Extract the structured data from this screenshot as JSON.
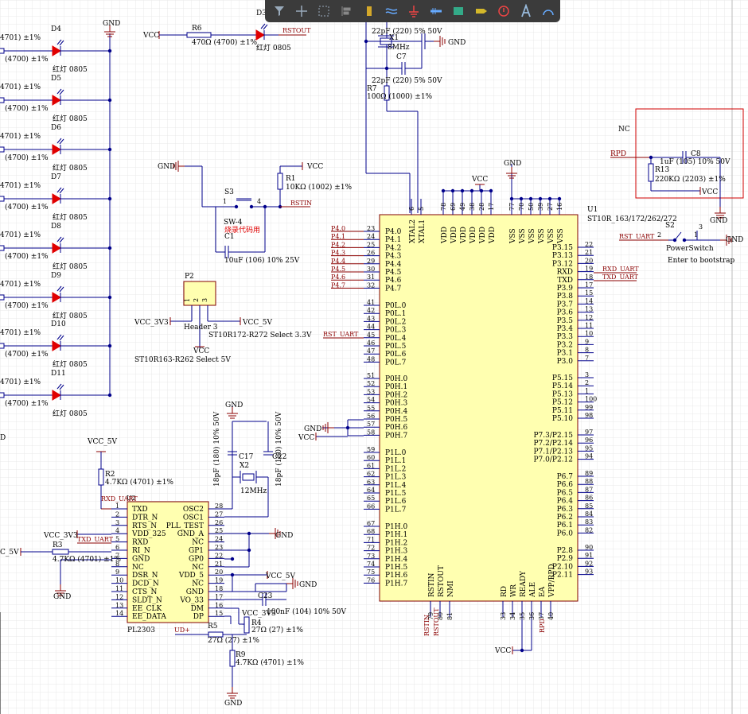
{
  "labels": {
    "gnd": "GND",
    "vcc": "VCC",
    "vcc_3v3": "VCC_3V3",
    "vcc_5v": "VCC_5V",
    "rstout": "RSTOUT",
    "rstin": "RSTIN",
    "rst_uart": "RST_UART",
    "rxd_uart": "RXD_UART",
    "txd_uart": "TXD_UART",
    "rpd": "RPD",
    "nc": "NC",
    "ud_plus": "UD+",
    "vcc_5v_short": "C_5V",
    "d_fragment": "D"
  },
  "leds": [
    {
      "ref": "D4",
      "r_value": "(4700) ±1%",
      "r_top": "4701) ±1%",
      "part": "红灯 0805"
    },
    {
      "ref": "D5",
      "r_value": "(4700) ±1%",
      "r_top": "4701) ±1%",
      "part": "红灯 0805"
    },
    {
      "ref": "D6",
      "r_value": "(4700) ±1%",
      "r_top": "4701) ±1%",
      "part": "红灯 0805"
    },
    {
      "ref": "D7",
      "r_value": "(4700) ±1%",
      "r_top": "4701) ±1%",
      "part": "红灯 0805"
    },
    {
      "ref": "D8",
      "r_value": "(4700) ±1%",
      "r_top": "4701) ±1%",
      "part": "红灯 0805"
    },
    {
      "ref": "D9",
      "r_value": "(4700) ±1%",
      "r_top": "4701) ±1%",
      "part": "红灯 0805"
    },
    {
      "ref": "D10",
      "r_value": "(4700) ±1%",
      "r_top": "4701) ±1%",
      "part": "红灯 0805"
    },
    {
      "ref": "D11",
      "r_value": "(4700) ±1%",
      "r_top": "4701) ±1%",
      "part": "红灯 0805"
    }
  ],
  "components": {
    "r6": {
      "ref": "R6",
      "value": "470Ω (4700) ±1%"
    },
    "d3": {
      "ref": "D3",
      "part": "红灯 0805"
    },
    "c_top": {
      "value": "22pF (220) 5% 50V"
    },
    "x1": {
      "ref": "X1",
      "value": "8MHz"
    },
    "c7": {
      "ref": "C7",
      "value": "22pF (220) 5% 50V"
    },
    "r7": {
      "ref": "R7",
      "value": "100Ω (1000) ±1%"
    },
    "r1": {
      "ref": "R1",
      "value": "10KΩ (1002) ±1%"
    },
    "s3": {
      "ref": "S3",
      "part": "SW-4",
      "note": "烧录代码用",
      "pin1": "1",
      "pin4": "4"
    },
    "c1": {
      "ref": "C1",
      "value": "10uF (106) 10% 25V"
    },
    "p2": {
      "ref": "P2",
      "part": "Header 3",
      "pins": [
        "1",
        "2",
        "3"
      ],
      "note": "ST10R172-R272 Select 3.3V",
      "note2": "ST10R163-R262 Select 5V"
    },
    "c8": {
      "ref": "C8",
      "value": "1uF (105) 10% 50V"
    },
    "r13": {
      "ref": "R13",
      "value": "220KΩ (2203) ±1%"
    },
    "s2": {
      "ref": "S2",
      "part": "PowerSwitch",
      "note": "Enter to bootstrap",
      "p1": "1",
      "p2": "2",
      "p3": "3"
    },
    "u1": {
      "ref": "U1",
      "part": "ST10R_163/172/262/272"
    },
    "r2": {
      "ref": "R2",
      "value": "4.7KΩ (4701) ±1%"
    },
    "r3": {
      "ref": "R3",
      "value": "4.7KΩ (4701) ±1%"
    },
    "r5": {
      "ref": "R5",
      "value": "27Ω (27) ±1%"
    },
    "r4": {
      "ref": "R4",
      "value": "27Ω (27) ±1%"
    },
    "r9": {
      "ref": "R9",
      "value": "4.7KΩ (4701) ±1%"
    },
    "c17": {
      "ref": "C17",
      "value": "18pF (180) 10% 50V"
    },
    "c22": {
      "ref": "C22",
      "value": "18pF (180) 10% 50V"
    },
    "x2": {
      "ref": "X2",
      "value": "12MHz"
    },
    "c23": {
      "ref": "C23",
      "value": "100nF (104) 10% 50V"
    },
    "pl2303": {
      "ref": "U2",
      "part": "PL2303"
    }
  },
  "u1_top_pins": [
    {
      "num": "6",
      "name": "XTAL2"
    },
    {
      "num": "5",
      "name": "XTAL1"
    },
    {
      "num": "78",
      "name": "VDD"
    },
    {
      "num": "69",
      "name": "VDD"
    },
    {
      "num": "49",
      "name": "VDD"
    },
    {
      "num": "38",
      "name": "VDD"
    },
    {
      "num": "28",
      "name": "VDD"
    },
    {
      "num": "17",
      "name": "VDD"
    },
    {
      "num": "77",
      "name": "VSS"
    },
    {
      "num": "70",
      "name": "VSS"
    },
    {
      "num": "50",
      "name": "VSS"
    },
    {
      "num": "39",
      "name": "VSS"
    },
    {
      "num": "27",
      "name": "VSS"
    },
    {
      "num": "16",
      "name": "VSS"
    }
  ],
  "u1_left_pins": [
    {
      "num": "23",
      "name": "P4.0",
      "net": "P4.0"
    },
    {
      "num": "24",
      "name": "P4.1",
      "net": "P4.1"
    },
    {
      "num": "25",
      "name": "P4.2",
      "net": "P4.2"
    },
    {
      "num": "26",
      "name": "P4.3",
      "net": "P4.3"
    },
    {
      "num": "29",
      "name": "P4.4",
      "net": "P4.4"
    },
    {
      "num": "30",
      "name": "P4.5",
      "net": "P4.5"
    },
    {
      "num": "31",
      "name": "P4.6",
      "net": "P4.6"
    },
    {
      "num": "32",
      "name": "P4.7",
      "net": "P4.7"
    },
    {
      "num": "41",
      "name": "P0L.0"
    },
    {
      "num": "42",
      "name": "P0L.1"
    },
    {
      "num": "43",
      "name": "P0L.2"
    },
    {
      "num": "44",
      "name": "P0L.3"
    },
    {
      "num": "45",
      "name": "P0L.4"
    },
    {
      "num": "46",
      "name": "P0L.5"
    },
    {
      "num": "47",
      "name": "P0L.6"
    },
    {
      "num": "48",
      "name": "P0L.7"
    },
    {
      "num": "51",
      "name": "P0H.0"
    },
    {
      "num": "52",
      "name": "P0H.1"
    },
    {
      "num": "53",
      "name": "P0H.2"
    },
    {
      "num": "54",
      "name": "P0H.3"
    },
    {
      "num": "55",
      "name": "P0H.4"
    },
    {
      "num": "56",
      "name": "P0H.5"
    },
    {
      "num": "57",
      "name": "P0H.6"
    },
    {
      "num": "58",
      "name": "P0H.7"
    },
    {
      "num": "59",
      "name": "P1L.0"
    },
    {
      "num": "60",
      "name": "P1L.1"
    },
    {
      "num": "61",
      "name": "P1L.2"
    },
    {
      "num": "62",
      "name": "P1L.3"
    },
    {
      "num": "63",
      "name": "P1L.4"
    },
    {
      "num": "64",
      "name": "P1L.5"
    },
    {
      "num": "65",
      "name": "P1L.6"
    },
    {
      "num": "66",
      "name": "P1L.7"
    },
    {
      "num": "67",
      "name": "P1H.0"
    },
    {
      "num": "68",
      "name": "P1H.1"
    },
    {
      "num": "71",
      "name": "P1H.2"
    },
    {
      "num": "72",
      "name": "P1H.3"
    },
    {
      "num": "73",
      "name": "P1H.4"
    },
    {
      "num": "74",
      "name": "P1H.5"
    },
    {
      "num": "75",
      "name": "P1H.6"
    },
    {
      "num": "76",
      "name": "P1H.7"
    }
  ],
  "u1_right_pins": [
    {
      "num": "22",
      "name": "P3.15"
    },
    {
      "num": "21",
      "name": "P3.13"
    },
    {
      "num": "20",
      "name": "P3.12"
    },
    {
      "num": "19",
      "name": "RXD"
    },
    {
      "num": "18",
      "name": "TXD"
    },
    {
      "num": "17",
      "name": "P3.9"
    },
    {
      "num": "15",
      "name": "P3.8"
    },
    {
      "num": "14",
      "name": "P3.7"
    },
    {
      "num": "13",
      "name": "P3.6"
    },
    {
      "num": "12",
      "name": "P3.5"
    },
    {
      "num": "11",
      "name": "P3.4"
    },
    {
      "num": "10",
      "name": "P3.3"
    },
    {
      "num": "9",
      "name": "P3.2"
    },
    {
      "num": "8",
      "name": "P3.1"
    },
    {
      "num": "7",
      "name": "P3.0"
    },
    {
      "num": "3",
      "name": "P5.15"
    },
    {
      "num": "2",
      "name": "P5.14"
    },
    {
      "num": "1",
      "name": "P5.13"
    },
    {
      "num": "100",
      "name": "P5.12"
    },
    {
      "num": "99",
      "name": "P5.11"
    },
    {
      "num": "98",
      "name": "P5.10"
    },
    {
      "num": "97",
      "name": "P7.3/P2.15"
    },
    {
      "num": "96",
      "name": "P7.2/P2.14"
    },
    {
      "num": "95",
      "name": "P7.1/P2.13"
    },
    {
      "num": "94",
      "name": "P7.0/P2.12"
    },
    {
      "num": "89",
      "name": "P6.7"
    },
    {
      "num": "88",
      "name": "P6.6"
    },
    {
      "num": "87",
      "name": "P6.5"
    },
    {
      "num": "86",
      "name": "P6.4"
    },
    {
      "num": "85",
      "name": "P6.3"
    },
    {
      "num": "84",
      "name": "P6.2"
    },
    {
      "num": "83",
      "name": "P6.1"
    },
    {
      "num": "82",
      "name": "P6.0"
    },
    {
      "num": "90",
      "name": "P2.8"
    },
    {
      "num": "91",
      "name": "P2.9"
    },
    {
      "num": "92",
      "name": "P2.10"
    },
    {
      "num": "93",
      "name": "P2.11"
    }
  ],
  "u1_bottom_pins": [
    {
      "num": "79",
      "name": "RSTIN"
    },
    {
      "num": "80",
      "name": "RSTOUT"
    },
    {
      "num": "81",
      "name": "NMI"
    },
    {
      "num": "33",
      "name": "RD"
    },
    {
      "num": "34",
      "name": "WR"
    },
    {
      "num": "35",
      "name": "READY"
    },
    {
      "num": "36",
      "name": "ALE"
    },
    {
      "num": "37",
      "name": "EA"
    },
    {
      "num": "40",
      "name": "VPP/RPD"
    }
  ],
  "pl2303_left": [
    {
      "num": "1",
      "name": "TXD"
    },
    {
      "num": "2",
      "name": "DTR_N"
    },
    {
      "num": "3",
      "name": "RTS_N"
    },
    {
      "num": "4",
      "name": "VDD_325"
    },
    {
      "num": "5",
      "name": "RXD"
    },
    {
      "num": "6",
      "name": "RI_N"
    },
    {
      "num": "7",
      "name": "GND"
    },
    {
      "num": "8",
      "name": "NC"
    },
    {
      "num": "9",
      "name": "DSR_N"
    },
    {
      "num": "10",
      "name": "DCD_N"
    },
    {
      "num": "11",
      "name": "CTS_N"
    },
    {
      "num": "12",
      "name": "SLDT_N"
    },
    {
      "num": "13",
      "name": "EE_CLK"
    },
    {
      "num": "14",
      "name": "EE_DATA"
    }
  ],
  "pl2303_right": [
    {
      "num": "28",
      "name": "OSC2"
    },
    {
      "num": "27",
      "name": "OSC1"
    },
    {
      "num": "26",
      "name": "PLL_TEST"
    },
    {
      "num": "25",
      "name": "GND_A"
    },
    {
      "num": "24",
      "name": "NC"
    },
    {
      "num": "23",
      "name": "GP1"
    },
    {
      "num": "22",
      "name": "GP0"
    },
    {
      "num": "21",
      "name": "NC"
    },
    {
      "num": "20",
      "name": "VDD_5"
    },
    {
      "num": "19",
      "name": "NC"
    },
    {
      "num": "18",
      "name": "GND"
    },
    {
      "num": "17",
      "name": "VO_33"
    },
    {
      "num": "16",
      "name": "DM"
    },
    {
      "num": "15",
      "name": "DP"
    }
  ],
  "toolbar": [
    "filter-icon",
    "crosshair-icon",
    "select-rect-icon",
    "align-icon",
    "component-icon",
    "wire-icon",
    "power-port-icon",
    "bus-icon",
    "harness-icon",
    "port-icon",
    "directive-icon",
    "text-icon",
    "arc-icon"
  ]
}
